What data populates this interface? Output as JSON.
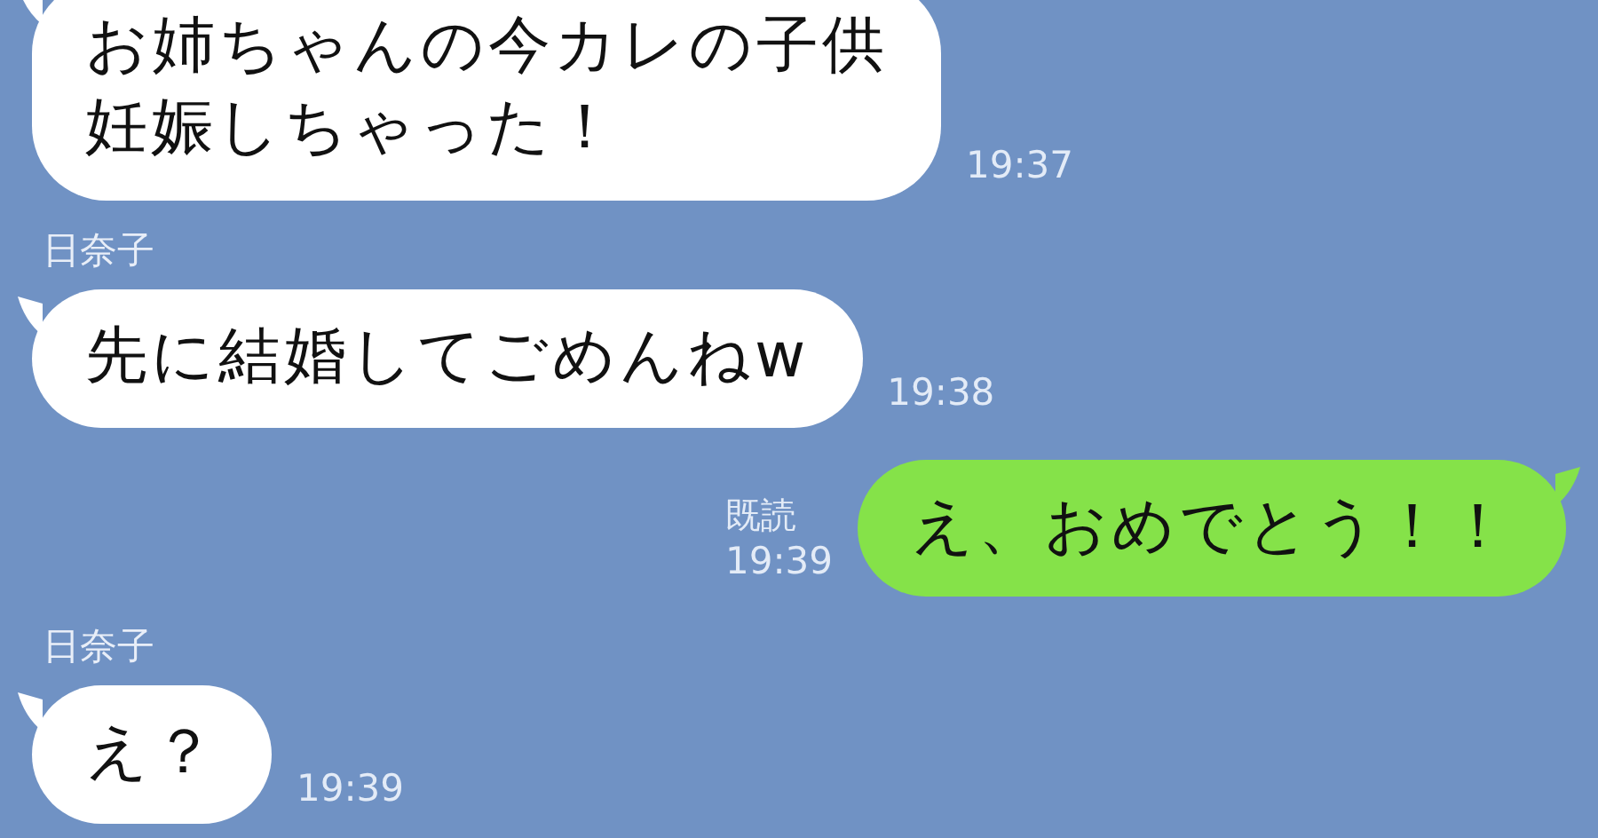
{
  "messages": [
    {
      "kind": "incoming",
      "lines": [
        "お姉ちゃんの今カレの子供",
        "妊娠しちゃった！"
      ],
      "time": "19:37"
    },
    {
      "kind": "incoming",
      "sender": "日奈子",
      "text": "先に結婚してごめんねw",
      "time": "19:38"
    },
    {
      "kind": "outgoing",
      "read_label": "既読",
      "text": "え、おめでとう！！",
      "time": "19:39"
    },
    {
      "kind": "incoming",
      "sender": "日奈子",
      "text": "え？",
      "time": "19:39"
    }
  ]
}
